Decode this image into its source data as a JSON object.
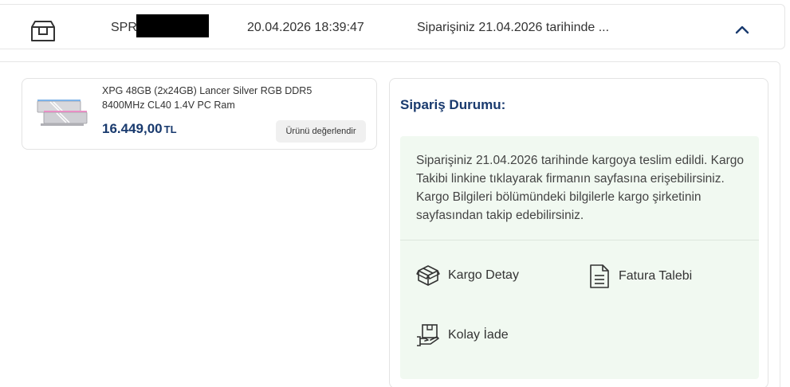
{
  "order": {
    "number_prefix": "SPR",
    "date": "20.04.2026 18:39:47",
    "status_summary": "Siparişiniz 21.04.2026 tarihinde ..."
  },
  "product": {
    "name": "XPG 48GB (2x24GB) Lancer Silver RGB DDR5 8400MHz CL40 1.4V PC Ram",
    "price": "16.449,00",
    "currency": "TL",
    "review_label": "Ürünü değerlendir"
  },
  "status": {
    "title": "Sipariş Durumu:",
    "message": "Siparişiniz 21.04.2026 tarihinde kargoya teslim edildi. Kargo Takibi linkine tıklayarak firmanın sayfasına erişebilirsiniz. Kargo Bilgileri bölümündeki bilgilerle kargo şirketinin sayfasından takip edebilirsiniz.",
    "actions": {
      "cargo": "Kargo Detay",
      "invoice": "Fatura Talebi",
      "return": "Kolay İade"
    }
  },
  "colors": {
    "brand_navy": "#193a6e",
    "status_bg": "#f1f9f1"
  },
  "icons": [
    "package-box-icon",
    "chevron-up-icon",
    "cargo-box-icon",
    "invoice-document-icon",
    "return-hand-box-icon"
  ]
}
